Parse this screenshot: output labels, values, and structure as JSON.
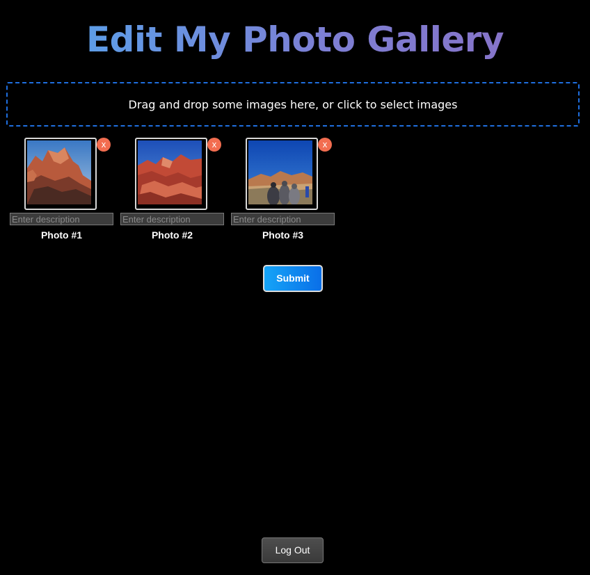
{
  "page": {
    "title": "Edit My Photo Gallery",
    "dropzone_text": "Drag and drop some images here, or click to select images"
  },
  "photos": [
    {
      "label": "Photo #1",
      "placeholder": "Enter description",
      "remove_label": "x",
      "description": "",
      "image": "red-rock-canyon-formation"
    },
    {
      "label": "Photo #2",
      "placeholder": "Enter description",
      "remove_label": "x",
      "description": "",
      "image": "red-rock-under-blue-sky"
    },
    {
      "label": "Photo #3",
      "placeholder": "Enter description",
      "remove_label": "x",
      "description": "",
      "image": "hikers-desert-mountains"
    }
  ],
  "actions": {
    "submit_label": "Submit",
    "logout_label": "Log Out"
  },
  "colors": {
    "background": "#000000",
    "dropzone_border": "#1f6fe0",
    "remove_button": "#f26d50",
    "submit_gradient_start": "#15a4f7",
    "submit_gradient_end": "#0a6fe8",
    "title_gradient_start": "#52a8ee",
    "title_gradient_end": "#8a6fc4"
  }
}
